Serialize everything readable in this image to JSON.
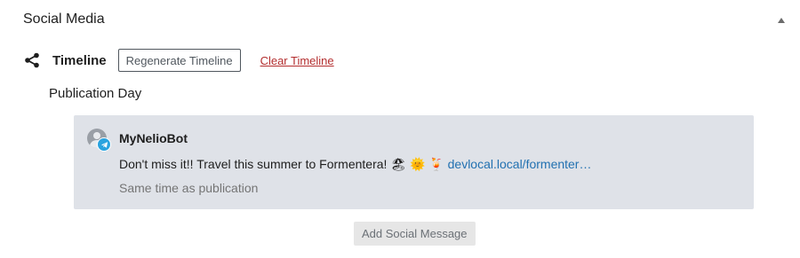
{
  "panel": {
    "title": "Social Media",
    "toggle_icon": "triangle-up-icon"
  },
  "timeline": {
    "icon": "share-icon",
    "label": "Timeline",
    "regenerate_label": "Regenerate Timeline",
    "clear_label": "Clear Timeline"
  },
  "publication_day": {
    "label": "Publication Day"
  },
  "message": {
    "author": "MyNelioBot",
    "network_icon": "telegram-icon",
    "text": "Don't miss it!! Travel this summer to Formentera! 🏖 🌞 🍹 ",
    "link": "devlocal.local/formenter…",
    "schedule": "Same time as publication"
  },
  "actions": {
    "add_label": "Add Social Message"
  },
  "colors": {
    "accent": "#2271b1",
    "danger": "#b32d2e",
    "card_background": "#dfe2e8",
    "telegram": "#2aa3df"
  }
}
